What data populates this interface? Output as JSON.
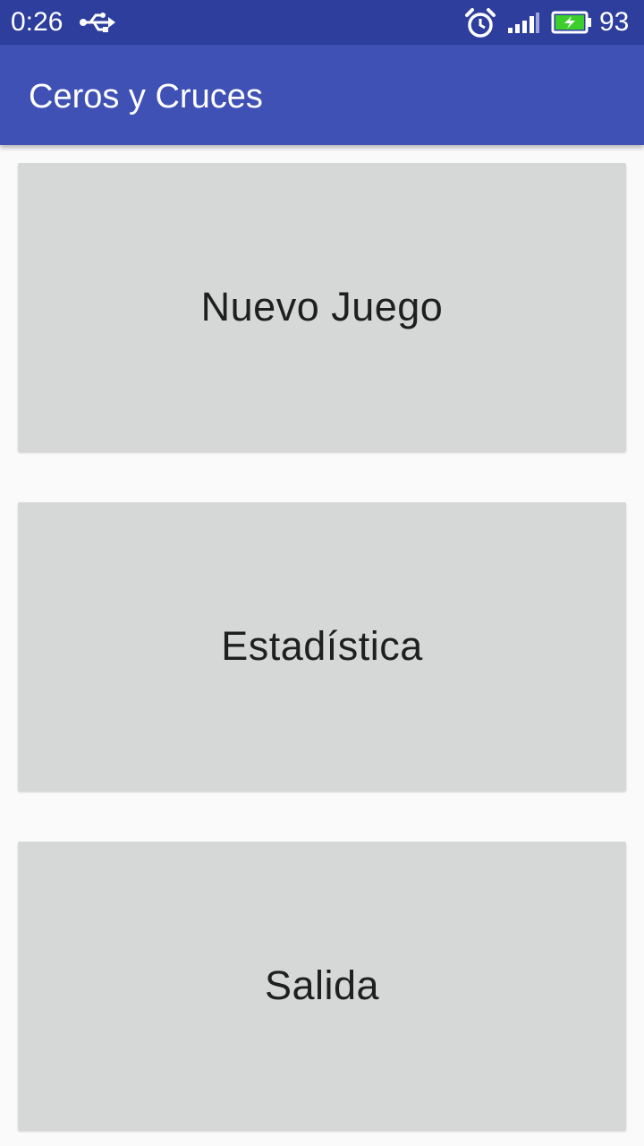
{
  "status_bar": {
    "time": "0:26",
    "battery_level": "93",
    "icons": [
      "usb-icon",
      "alarm-icon",
      "signal-icon",
      "battery-charging-icon"
    ]
  },
  "app_bar": {
    "title": "Ceros y Cruces"
  },
  "menu": {
    "buttons": [
      {
        "label": "Nuevo Juego"
      },
      {
        "label": "Estadística"
      },
      {
        "label": "Salida"
      }
    ]
  },
  "colors": {
    "status_bar": "#2d3e9d",
    "app_bar": "#3f51b5",
    "button": "#d6d7d7",
    "background": "#fafafa",
    "battery_fill": "#3ccf2c"
  }
}
